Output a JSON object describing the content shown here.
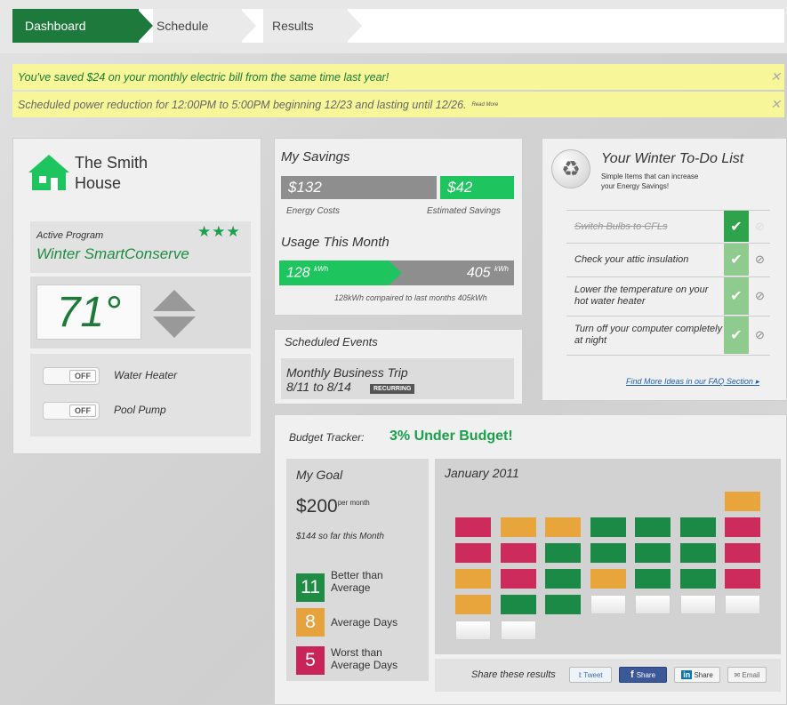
{
  "nav": {
    "tabs": [
      {
        "label": "Dashboard"
      },
      {
        "label": "Schedule"
      },
      {
        "label": "Results"
      }
    ]
  },
  "alerts": [
    {
      "text": "You've saved $24 on your monthly electric bill from the same time last year!"
    },
    {
      "text": "Scheduled power reduction for 12:00PM to 5:00PM beginning 12/23 and lasting until 12/26.",
      "link": "Read More"
    }
  ],
  "house": {
    "name_line1": "The Smith",
    "name_line2": "House",
    "active_label": "Active Program",
    "stars": "★★★",
    "program": "Winter SmartConserve",
    "temperature": "71°",
    "devices": [
      {
        "state": "OFF",
        "label": "Water Heater"
      },
      {
        "state": "OFF",
        "label": "Pool Pump"
      }
    ]
  },
  "savings": {
    "title": "My Savings",
    "energy_cost": "$132",
    "energy_cost_label": "Energy Costs",
    "estimated": "$42",
    "estimated_label": "Estimated Savings",
    "usage_title": "Usage This Month",
    "usage_current": "128",
    "usage_unit": "kWh",
    "usage_last": "405",
    "usage_fraction": 0.47,
    "usage_caption": "128kWh compaired to last months 405kWh"
  },
  "events": {
    "title": "Scheduled Events",
    "name": "Monthly Business Trip",
    "dates": "8/11 to 8/14",
    "badge": "RECURRING"
  },
  "todo": {
    "title": "Your Winter To-Do List",
    "subtitle_1": "Simple Items that can increase",
    "subtitle_2": "your Energy Savings!",
    "items": [
      {
        "text": "Switch Bulbs to CFLs",
        "done": true
      },
      {
        "text": "Check your attic insulation",
        "done": false
      },
      {
        "text": "Lower the temperature on your hot water heater",
        "done": false
      },
      {
        "text": "Turn off your computer completely at night",
        "done": false
      }
    ],
    "faq_link": "Find More Ideas in our FAQ Section ▸"
  },
  "budget": {
    "label": "Budget Tracker:",
    "status": "3% Under Budget!",
    "goal_title": "My Goal",
    "goal_amount": "$200",
    "goal_unit": "per month",
    "so_far": "$144 so far this Month",
    "legend": [
      {
        "count": "11",
        "label": "Better than Average",
        "color": "#1e8c42"
      },
      {
        "count": "8",
        "label": "Average Days",
        "color": "#e6a23c"
      },
      {
        "count": "5",
        "label": "Worst than Average Days",
        "color": "#c8245a"
      }
    ],
    "calendar_title": "January 2011",
    "calendar_cells": [
      [
        "",
        "",
        "",
        "",
        "",
        "",
        "avg"
      ],
      [
        "worst",
        "avg",
        "avg",
        "better",
        "better",
        "better",
        "worst"
      ],
      [
        "worst",
        "worst",
        "better",
        "better",
        "better",
        "better",
        "worst"
      ],
      [
        "avg",
        "worst",
        "better",
        "avg",
        "better",
        "better",
        "worst"
      ],
      [
        "avg",
        "better",
        "better",
        "blank",
        "blank",
        "blank",
        "blank"
      ],
      [
        "blank",
        "blank",
        "",
        "",
        "",
        "",
        ""
      ]
    ],
    "colors": {
      "better": "#1a8a46",
      "avg": "#e8a53c",
      "worst": "#cd2b5b",
      "blank": "#f4f4f4"
    }
  },
  "share": {
    "label": "Share these results",
    "buttons": [
      "Tweet",
      "Share",
      "Share",
      "Email"
    ]
  }
}
